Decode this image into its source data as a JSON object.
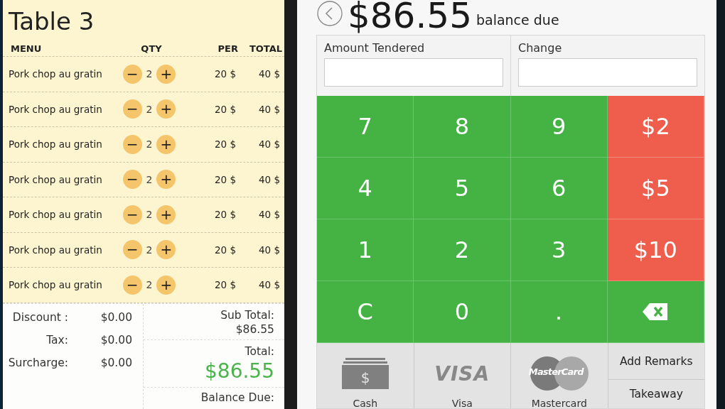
{
  "order": {
    "title": "Table 3",
    "columns": [
      "MENU",
      "QTY",
      "PER",
      "TOTAL"
    ],
    "rows": [
      {
        "item": "Pork chop au gratin",
        "minus": "−",
        "qty": "2",
        "plus": "+",
        "per": "20 $",
        "total": "40 $"
      },
      {
        "item": "Pork chop au gratin",
        "minus": "−",
        "qty": "2",
        "plus": "+",
        "per": "20 $",
        "total": "40 $"
      },
      {
        "item": "Pork chop au gratin",
        "minus": "−",
        "qty": "2",
        "plus": "+",
        "per": "20 $",
        "total": "40 $"
      },
      {
        "item": "Pork chop au gratin",
        "minus": "−",
        "qty": "2",
        "plus": "+",
        "per": "20 $",
        "total": "40 $"
      },
      {
        "item": "Pork chop au gratin",
        "minus": "−",
        "qty": "2",
        "plus": "+",
        "per": "20 $",
        "total": "40 $"
      },
      {
        "item": "Pork chop au gratin",
        "minus": "−",
        "qty": "2",
        "plus": "+",
        "per": "20 $",
        "total": "40 $"
      },
      {
        "item": "Pork chop au gratin",
        "minus": "−",
        "qty": "2",
        "plus": "+",
        "per": "20 $",
        "total": "40 $"
      }
    ],
    "adjustments": [
      {
        "label": "Discount :",
        "value": "$0.00"
      },
      {
        "label": "Tax:",
        "value": "$0.00"
      },
      {
        "label": "Surcharge:",
        "value": "$0.00"
      }
    ],
    "sub_total": {
      "label": "Sub Total:",
      "value": "$86.55"
    },
    "total": {
      "label": "Total:",
      "value": "$86.55"
    },
    "balance_due_label": "Balance Due:"
  },
  "payment": {
    "amount": "$86.55",
    "amount_caption": "balance due",
    "fields": [
      {
        "label": "Amount Tendered"
      },
      {
        "label": "Change"
      }
    ],
    "keys": [
      {
        "kind": "digit",
        "label": "7"
      },
      {
        "kind": "digit",
        "label": "8"
      },
      {
        "kind": "digit",
        "label": "9"
      },
      {
        "kind": "cash",
        "label": "$2"
      },
      {
        "kind": "digit",
        "label": "4"
      },
      {
        "kind": "digit",
        "label": "5"
      },
      {
        "kind": "digit",
        "label": "6"
      },
      {
        "kind": "cash",
        "label": "$5"
      },
      {
        "kind": "digit",
        "label": "1"
      },
      {
        "kind": "digit",
        "label": "2"
      },
      {
        "kind": "digit",
        "label": "3"
      },
      {
        "kind": "cash",
        "label": "$10"
      },
      {
        "kind": "digit",
        "label": "C"
      },
      {
        "kind": "digit",
        "label": "0"
      },
      {
        "kind": "digit",
        "label": "."
      },
      {
        "kind": "backspace"
      }
    ],
    "methods": [
      {
        "kind": "cash",
        "label": "Cash",
        "icon_glyph": "$"
      },
      {
        "kind": "visa",
        "label": "Visa",
        "logo_text": "VISA"
      },
      {
        "kind": "mastercard",
        "label": "Mastercard",
        "logo_text": "MasterCard"
      }
    ],
    "actions": [
      "Add Remarks",
      "Takeaway"
    ]
  }
}
